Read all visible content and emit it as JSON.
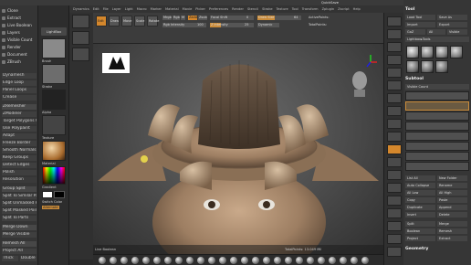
{
  "menu": {
    "items": [
      "Alpha",
      "Brush",
      "Color",
      "Document",
      "Draw",
      "Dynamics",
      "Edit",
      "File",
      "Layer",
      "Light",
      "Macro",
      "Marker",
      "Material",
      "Movie",
      "Picker",
      "Preferences",
      "Render",
      "Stencil",
      "Stroke",
      "Texture",
      "Tool",
      "Transform",
      "Zplugin",
      "Zscript",
      "Help"
    ],
    "quicksave": "QuickSave"
  },
  "left_panel": {
    "items": [
      "Clone",
      "Extract",
      "Live Boolean",
      "Layers",
      "Visible Count",
      "Render",
      "Document",
      "ZBrush"
    ]
  },
  "palette": {
    "lightbox": "LightBox"
  },
  "toolbar": {
    "edit": "Edit",
    "draw": "Draw",
    "move": "Move",
    "scale": "Scale",
    "rotate": "Rotate",
    "mrgb": "Mrgb",
    "rgb": "Rgb",
    "m": "M",
    "zadd": "Zadd",
    "zsub": "Zsub",
    "focal_label": "Focal Shift",
    "focal_value": "0",
    "draw_size_label": "Draw Size",
    "draw_size_value": "64",
    "rgb_intensity_label": "Rgb Intensity",
    "rgb_intensity_value": "100",
    "z_intensity_label": "Z Intensity",
    "z_intensity_value": "25",
    "dynamic": "Dynamic",
    "active_points_label": "ActivePoints:",
    "total_points_label": "TotalPoints:"
  },
  "right_panel": {
    "tool_label": "Tool",
    "load_tool": "Load Tool",
    "save_as": "Save As",
    "import": "Import",
    "export": "Export",
    "goz": "GoZ",
    "all": "All",
    "visible": "Visible",
    "r": "R",
    "lightbox_tools": "Lightbox▸Tools",
    "subtool": "Subtool",
    "geometry": "Geometry",
    "visible_count_label": "Visible Count",
    "split": "Split",
    "merge": "Merge",
    "boolean": "Boolean",
    "remesh": "Remesh",
    "project": "Project",
    "extract": "Extract",
    "list_all": "List All",
    "new_folder": "New Folder",
    "auto_collapse": "Auto Collapse",
    "rename": "Rename",
    "all_low": "All Low",
    "all_high": "All High",
    "copy": "Copy",
    "paste": "Paste",
    "duplicate": "Duplicate",
    "append": "Append",
    "insert": "Insert",
    "delete": "Delete"
  },
  "palette_left": {
    "items": [
      "Brush",
      "Draw",
      "Stroke",
      "Alpha",
      "Texture",
      "Material",
      "Gradient",
      "Switch Color",
      "Alternate"
    ]
  },
  "left_subpanel": {
    "items": [
      "Dynamesh",
      "Edge Loop",
      "Panel Loops",
      "Crease",
      "ZRemesher",
      "ZModeler",
      "Target Polygons Count",
      "Use Polypaint",
      "Adapt",
      "Freeze Border",
      "Smooth Normals",
      "Keep Groups",
      "Detect Edges",
      "Polish",
      "Resolution",
      "Group Split",
      "Split To Similar Parts",
      "Split Unmasked Points",
      "Split Masked Points",
      "Split To Parts",
      "Merge Down",
      "Merge Visible",
      "Remesh All",
      "Project All",
      "Thick",
      "Double"
    ]
  },
  "status": {
    "bottom_left": "Live Boolean",
    "bottom_right": "TotalPoints: 13.049 Mil"
  },
  "colors": {
    "accent": "#d4872c",
    "panel": "#363636",
    "viewport_bg": "#5a5a5a"
  }
}
